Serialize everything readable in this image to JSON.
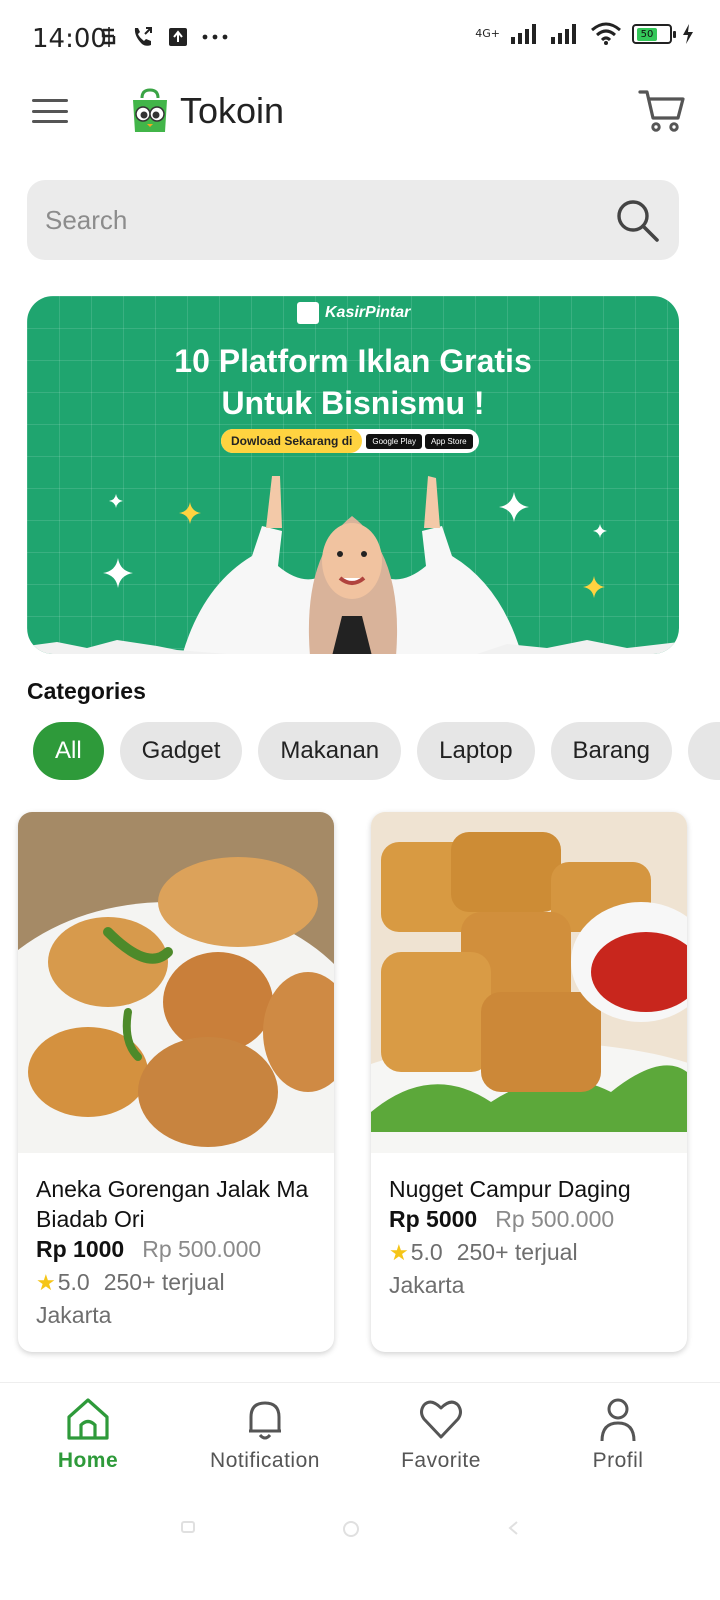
{
  "status_bar": {
    "time": "14:00",
    "network_label": "4G+",
    "battery_level": "50"
  },
  "header": {
    "title": "Tokoin",
    "menu_icon": "hamburger-icon",
    "cart_icon": "cart-icon"
  },
  "search": {
    "placeholder": "Search",
    "icon": "search-icon"
  },
  "banner": {
    "brand": "KasirPintar",
    "title_line1": "10 Platform Iklan Gratis",
    "title_line2": "Untuk Bisnismu !",
    "cta": "Dowload Sekarang di",
    "badge_google": "Google Play",
    "badge_apple": "App Store",
    "background_color": "#1fa56f"
  },
  "categories": {
    "title": "Categories",
    "items": [
      {
        "label": "All",
        "active": true
      },
      {
        "label": "Gadget",
        "active": false
      },
      {
        "label": "Makanan",
        "active": false
      },
      {
        "label": "Laptop",
        "active": false
      },
      {
        "label": "Barang",
        "active": false
      },
      {
        "label": "",
        "active": false
      }
    ],
    "active_color": "#2e9a3a"
  },
  "products": [
    {
      "name": "Aneka Gorengan Jalak Ma Biadab Ori",
      "price": "Rp 1000",
      "old_price": "Rp 500.000",
      "rating": "5.0",
      "sold": "250+ terjual",
      "location": "Jakarta"
    },
    {
      "name": "Nugget Campur Daging",
      "price": "Rp 5000",
      "old_price": "Rp 500.000",
      "rating": "5.0",
      "sold": "250+ terjual",
      "location": "Jakarta"
    }
  ],
  "bottom_nav": {
    "items": [
      {
        "label": "Home",
        "icon": "home-icon",
        "active": true
      },
      {
        "label": "Notification",
        "icon": "bell-icon",
        "active": false
      },
      {
        "label": "Favorite",
        "icon": "heart-icon",
        "active": false
      },
      {
        "label": "Profil",
        "icon": "user-icon",
        "active": false
      }
    ]
  }
}
